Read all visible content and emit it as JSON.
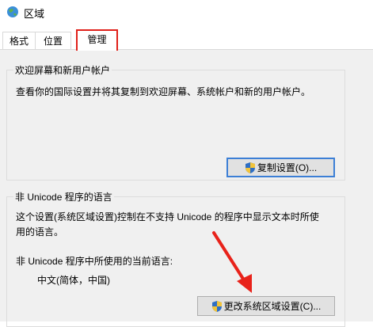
{
  "window": {
    "title": "区域",
    "icon": "globe-icon"
  },
  "tabs": [
    {
      "label": "格式"
    },
    {
      "label": "位置"
    },
    {
      "label": "管理",
      "selected": true
    }
  ],
  "welcome_group": {
    "legend": "欢迎屏幕和新用户帐户",
    "description": "查看你的国际设置并将其复制到欢迎屏幕、系统帐户和新的用户帐户。",
    "button_label": "复制设置(O)..."
  },
  "nonunicode_group": {
    "legend": "非 Unicode 程序的语言",
    "description_line1": "这个设置(系统区域设置)控制在不支持 Unicode 的程序中显示文本时所使",
    "description_line2": "用的语言。",
    "current_label": "非 Unicode 程序中所使用的当前语言:",
    "current_value": "中文(简体，中国)",
    "button_label": "更改系统区域设置(C)..."
  },
  "colors": {
    "highlight": "#e0201a",
    "accent": "#3c7fd6",
    "panel": "#f0f0f0"
  }
}
